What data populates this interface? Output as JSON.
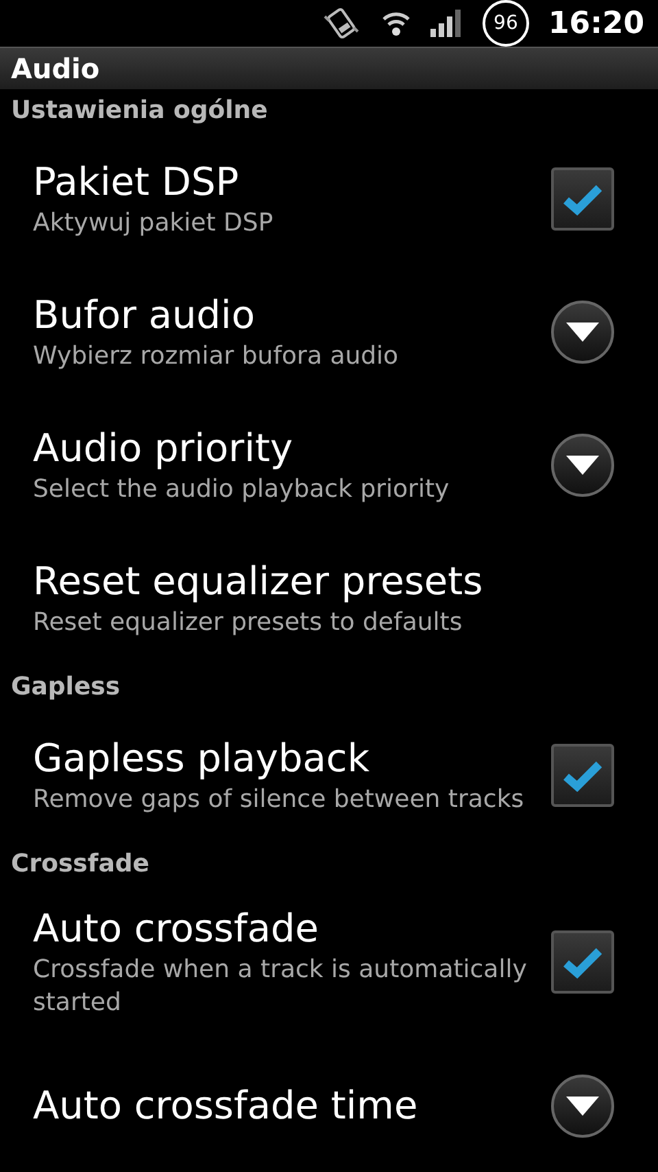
{
  "status_bar": {
    "battery": "96",
    "time": "16:20"
  },
  "title_bar": {
    "title": "Audio"
  },
  "sections": [
    {
      "header": "Ustawienia ogólne",
      "items": [
        {
          "kind": "checkbox",
          "title": "Pakiet DSP",
          "summary": "Aktywuj pakiet DSP",
          "checked": true
        },
        {
          "kind": "dropdown",
          "title": "Bufor audio",
          "summary": "Wybierz rozmiar bufora audio"
        },
        {
          "kind": "dropdown",
          "title": "Audio priority",
          "summary": "Select the audio playback priority"
        },
        {
          "kind": "plain",
          "title": "Reset equalizer presets",
          "summary": "Reset equalizer presets to defaults"
        }
      ]
    },
    {
      "header": "Gapless",
      "items": [
        {
          "kind": "checkbox",
          "title": "Gapless playback",
          "summary": "Remove gaps of silence between tracks",
          "checked": true
        }
      ]
    },
    {
      "header": "Crossfade",
      "items": [
        {
          "kind": "checkbox",
          "title": "Auto crossfade",
          "summary": "Crossfade when a track is automatically started",
          "checked": true
        },
        {
          "kind": "dropdown",
          "title": "Auto crossfade time"
        }
      ]
    }
  ]
}
